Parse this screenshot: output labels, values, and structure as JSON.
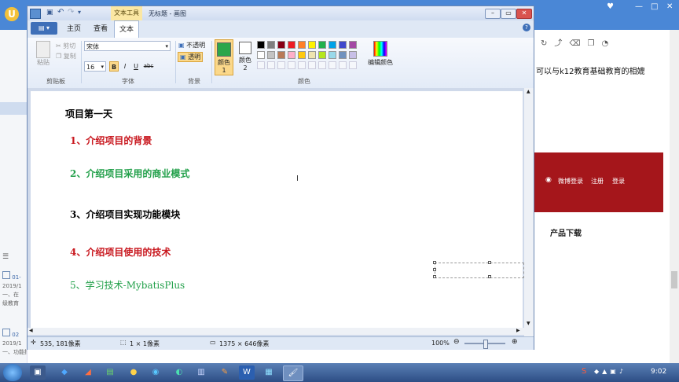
{
  "browser": {
    "right_toolbar_icons": [
      "refresh-icon",
      "share-icon",
      "delete-icon",
      "copy-icon",
      "alarm-icon"
    ],
    "right_text": "可以与k12教育基础教育的相媲",
    "banner_links": [
      "微博登录",
      "注册",
      "登录"
    ],
    "product_download": "产品下载",
    "left_items": [
      {
        "title": "01-",
        "date": "2019/1",
        "snippet": "一、在",
        "snippet2": "级教育"
      },
      {
        "title": "02",
        "date": "2019/1",
        "snippet": "一、功能描述 我想的，是一个"
      }
    ],
    "banner_color": "#a5161b"
  },
  "paint": {
    "title": "无标题 - 画图",
    "context_tab": "文本工具",
    "tabs": [
      "主页",
      "查看",
      "文本"
    ],
    "active_tab": "文本",
    "clipboard": {
      "paste": "粘贴",
      "cut": "剪切",
      "copy": "复制",
      "group": "剪贴板"
    },
    "font": {
      "family": "宋体",
      "size": "16",
      "group": "字体",
      "bold": "B",
      "italic": "I",
      "underline": "U",
      "strike": "abc"
    },
    "background": {
      "opaque": "不透明",
      "transparent": "透明",
      "group": "背景"
    },
    "colors": {
      "color1": "颜色 1",
      "color2": "颜色 2",
      "edit": "编辑颜色",
      "group": "颜色",
      "color1_value": "#2da64a",
      "palette": [
        "#000000",
        "#7f7f7f",
        "#880015",
        "#ed1c24",
        "#ff7f27",
        "#fff200",
        "#22b14c",
        "#00a2e8",
        "#3f48cc",
        "#a349a4",
        "#ffffff",
        "#c3c3c3",
        "#b97a57",
        "#ffaec9",
        "#ffc90e",
        "#efe4b0",
        "#b5e61d",
        "#99d9ea",
        "#7092be",
        "#c8bfe7"
      ]
    },
    "canvas_lines": [
      {
        "text": "项目第一天",
        "color": "#000000"
      },
      {
        "text": "1、介绍项目的背景",
        "color": "#c8161d"
      },
      {
        "text": "2、介绍项目采用的商业模式",
        "color": "#22a04a"
      },
      {
        "text": "3、介绍项目实现功能模块",
        "color": "#000000"
      },
      {
        "text": "4、介绍项目使用的技术",
        "color": "#c8161d"
      },
      {
        "text": "5、学习技术-MybatisPlus",
        "color": "#22a04a"
      }
    ],
    "status": {
      "cursor": "535, 181像素",
      "selection": "1 × 1像素",
      "size": "1375 × 646像素",
      "zoom": "100%"
    }
  },
  "taskbar": {
    "clock": "9:02"
  }
}
